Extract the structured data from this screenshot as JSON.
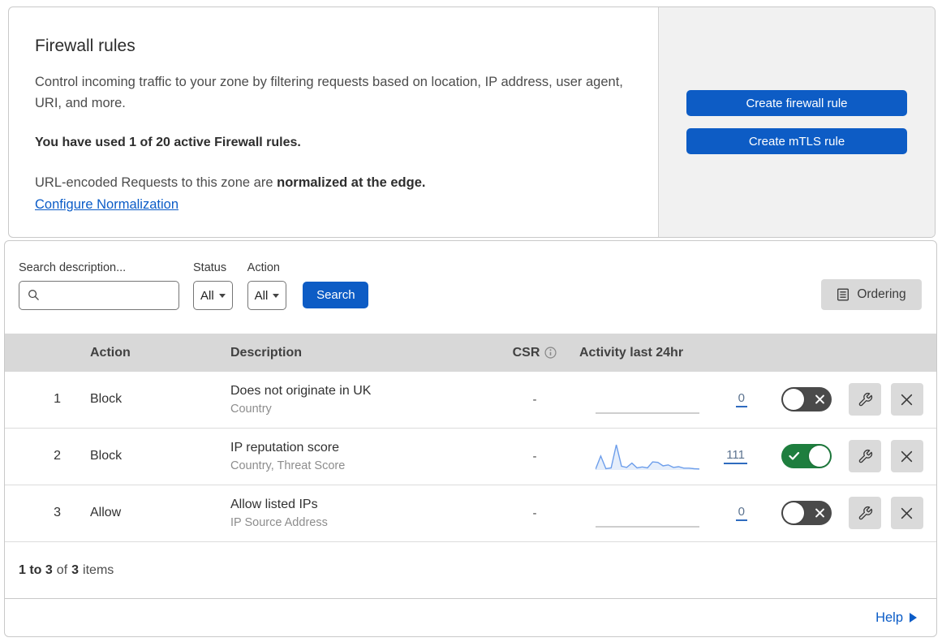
{
  "overview": {
    "title": "Firewall rules",
    "description": "Control incoming traffic to your zone by filtering requests based on location, IP address, user agent, URI, and more.",
    "usage": "You have used 1 of 20 active Firewall rules.",
    "normalization_prefix": "URL-encoded Requests to this zone are",
    "normalization_bold": "normalized at the edge.",
    "normalization_link": "Configure Normalization",
    "create_firewall_rule_label": "Create firewall rule",
    "create_mtls_rule_label": "Create mTLS rule"
  },
  "filters": {
    "search_label": "Search description...",
    "search_value": "",
    "status_label": "Status",
    "status_value": "All",
    "action_label": "Action",
    "action_value": "All",
    "search_button_label": "Search",
    "ordering_button_label": "Ordering"
  },
  "table": {
    "headers": {
      "action": "Action",
      "description": "Description",
      "csr": "CSR",
      "activity": "Activity last 24hr"
    },
    "rows": [
      {
        "priority": "1",
        "action": "Block",
        "description": "Does not originate in UK",
        "fields": "Country",
        "csr": "-",
        "activity_count": "0",
        "activity_points": null,
        "enabled": false
      },
      {
        "priority": "2",
        "action": "Block",
        "description": "IP reputation score",
        "fields": "Country, Threat Score",
        "csr": "-",
        "activity_count": "111",
        "activity_points": [
          3,
          55,
          5,
          8,
          100,
          15,
          10,
          27,
          8,
          12,
          8,
          32,
          30,
          16,
          20,
          10,
          13,
          7,
          7,
          5,
          4
        ],
        "enabled": true
      },
      {
        "priority": "3",
        "action": "Allow",
        "description": "Allow listed IPs",
        "fields": "IP Source Address",
        "csr": "-",
        "activity_count": "0",
        "activity_points": null,
        "enabled": false
      }
    ]
  },
  "footer": {
    "range": "1 to 3",
    "of_label": "of",
    "total": "3",
    "items_label": "items",
    "help_label": "Help"
  },
  "colors": {
    "primary_button": "#0d5cc5",
    "link": "#0b5cc7",
    "toggle_on": "#1e7e3e",
    "toggle_off": "#4a4a4a",
    "sparkline": "#6d9eeb",
    "panel_background": "#f1f1f1",
    "table_header_background": "#d8d8d8"
  }
}
